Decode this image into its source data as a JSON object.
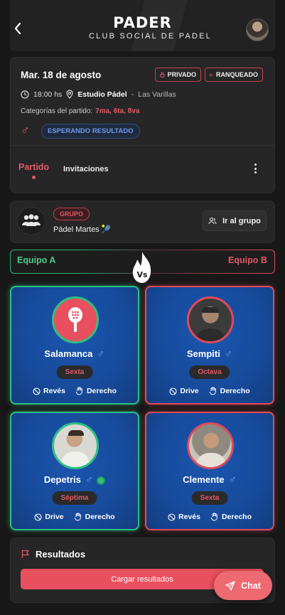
{
  "header": {
    "title": "PADER",
    "subtitle": "CLUB SOCIAL DE PADEL"
  },
  "match": {
    "date": "Mar. 18 de agosto",
    "tags": {
      "private": "PRIVADO",
      "ranked": "RANQUEADO"
    },
    "time": "18:00 hs",
    "venue": "Estudio Pádel",
    "separator": "-",
    "city": "Las Varillas",
    "categories_label": "Categorías del partido:",
    "categories": "7ma, 6ta, 8va",
    "gender_symbol": "♂",
    "status": "ESPERANDO RESULTADO",
    "tabs": {
      "match": "Partido",
      "invitations": "Invitaciones"
    }
  },
  "group": {
    "badge": "GRUPO",
    "name": "Pádel Martes 🎾",
    "button": "Ir al grupo"
  },
  "teams": {
    "a": "Equipo A",
    "b": "Equipo B",
    "vs": "Vs"
  },
  "players": [
    {
      "name": "Salamanca",
      "gender": "♂",
      "level": "Sexta",
      "side": "Revés",
      "hand": "Derecho"
    },
    {
      "name": "Sempiti",
      "gender": "♂",
      "level": "Octava",
      "side": "Drive",
      "hand": "Derecho"
    },
    {
      "name": "Depetris",
      "gender": "♂",
      "level": "Séptima",
      "side": "Drive",
      "hand": "Derecho"
    },
    {
      "name": "Clemente",
      "gender": "♂",
      "level": "Sexta",
      "side": "Revés",
      "hand": "Derecho"
    }
  ],
  "results": {
    "title": "Resultados",
    "button": "Cargar resultados"
  },
  "chat": {
    "label": "Chat"
  },
  "colors": {
    "accent": "#e35866",
    "team_a": "#2fc083",
    "team_b": "#e04a5a",
    "card_blue": "#1b56b0",
    "status_blue": "#6e9bf0"
  }
}
